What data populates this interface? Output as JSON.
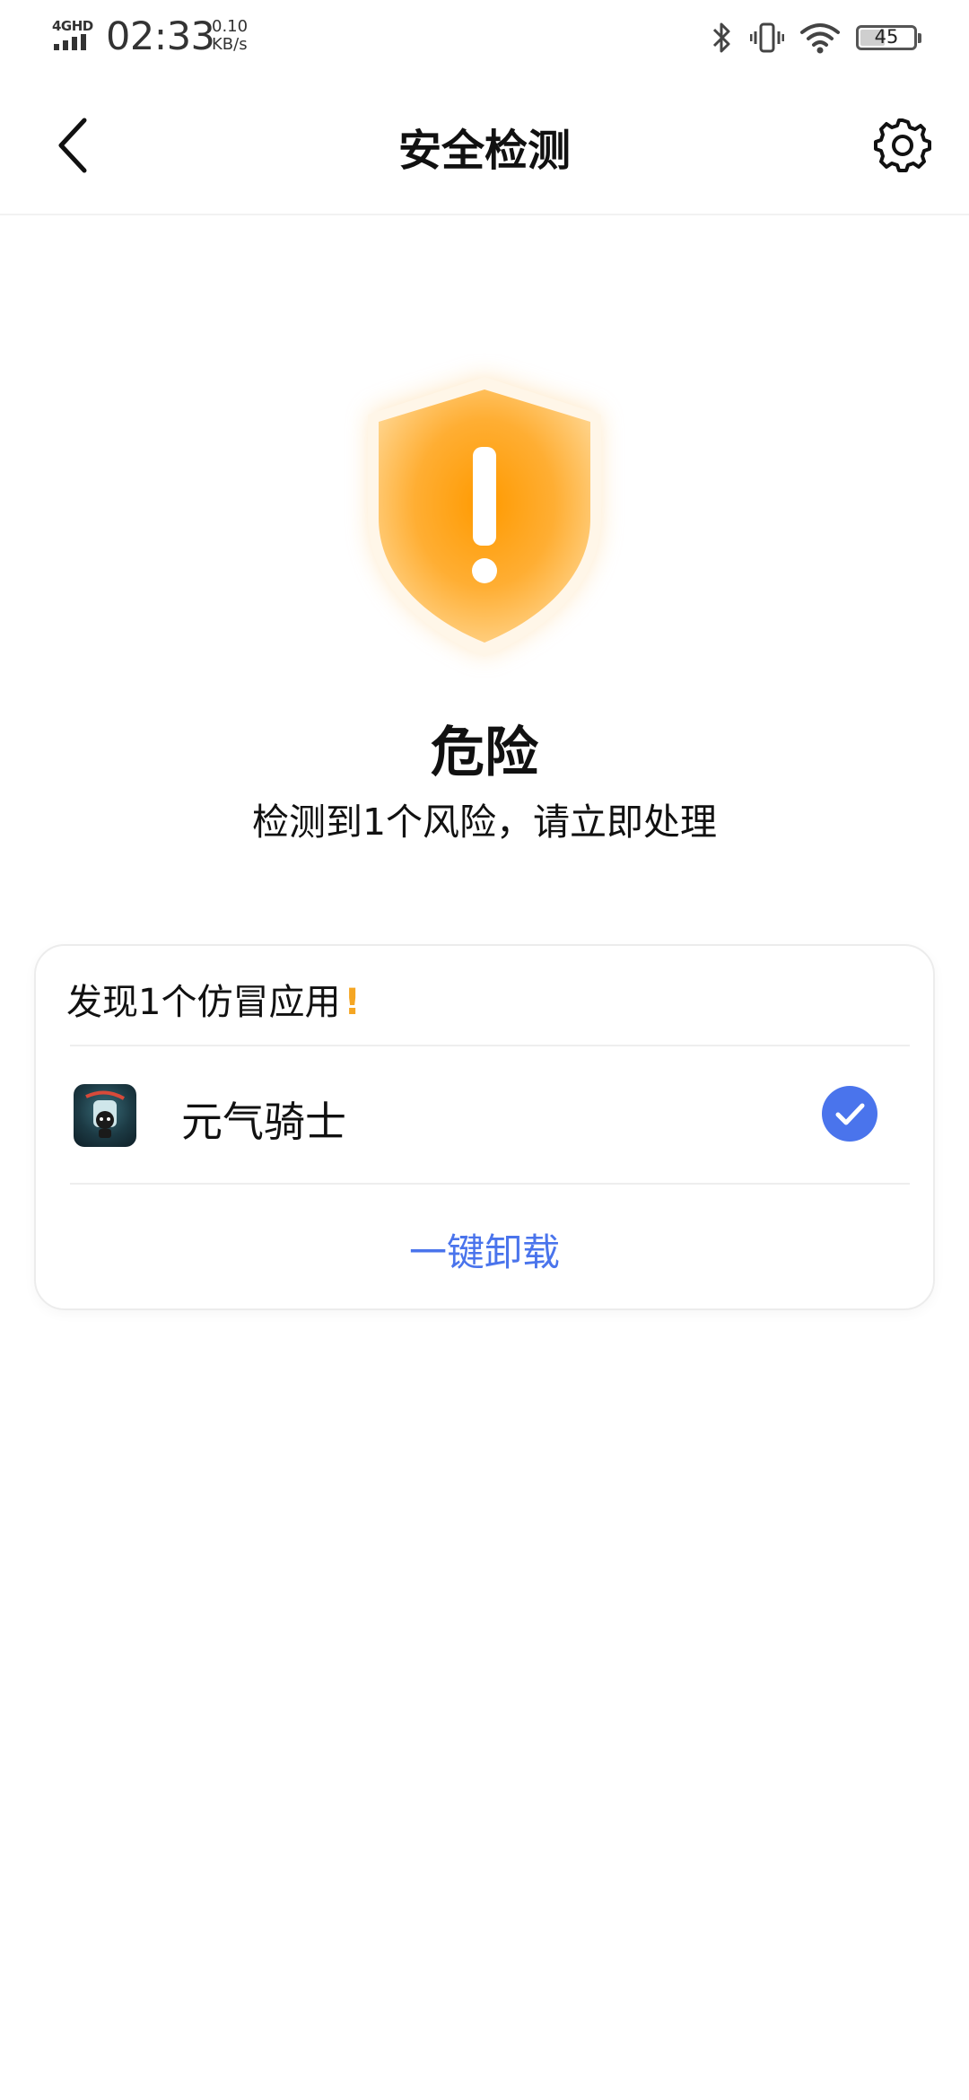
{
  "status_bar": {
    "network": "4GHD",
    "time": "02:33",
    "speed_value": "0.10",
    "speed_unit": "KB/s",
    "battery": "45",
    "icons": [
      "bluetooth-icon",
      "vibrate-icon",
      "wifi-icon",
      "battery-icon"
    ]
  },
  "header": {
    "title": "安全检测",
    "back_icon": "chevron-left-icon",
    "settings_icon": "gear-icon"
  },
  "status": {
    "icon": "warning-shield-icon",
    "title": "危险",
    "description": "检测到1个风险，请立即处理"
  },
  "card": {
    "header": "发现1个仿冒应用",
    "warn_mark": "!",
    "apps": [
      {
        "name": "元气骑士",
        "selected": true,
        "icon": "app-icon"
      }
    ],
    "action_label": "一键卸载"
  },
  "colors": {
    "accent": "#4A74EC",
    "warning": "#F5A623",
    "shield_orange": "#FFA31A"
  }
}
